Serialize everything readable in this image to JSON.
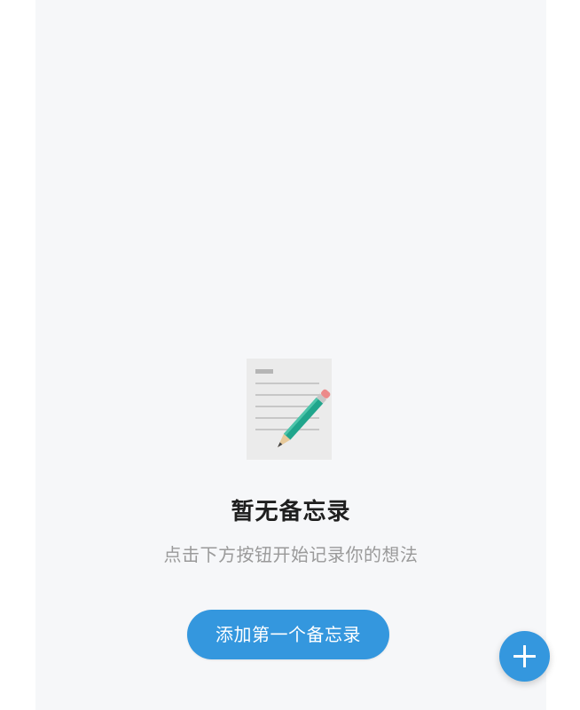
{
  "empty_state": {
    "title": "暂无备忘录",
    "subtitle": "点击下方按钮开始记录你的想法",
    "illustration_icon": "notepad-pencil-icon"
  },
  "actions": {
    "add_first_label": "添加第一个备忘录",
    "fab_icon": "plus-icon"
  },
  "colors": {
    "background": "#f6f7f9",
    "accent": "#3497de",
    "title": "#1f1f1f",
    "subtitle": "#9a9a9a"
  }
}
